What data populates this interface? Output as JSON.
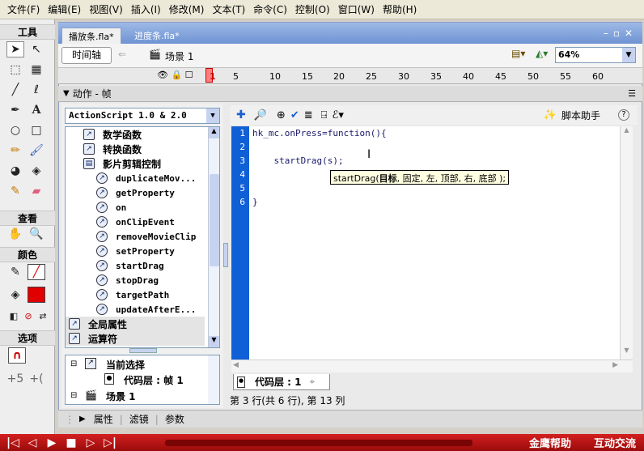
{
  "menu": [
    "文件(F)",
    "编辑(E)",
    "视图(V)",
    "插入(I)",
    "修改(M)",
    "文本(T)",
    "命令(C)",
    "控制(O)",
    "窗口(W)",
    "帮助(H)"
  ],
  "tools": {
    "title": "工具",
    "view": "查看",
    "colors": "颜色",
    "options": "选项"
  },
  "doc_tabs": [
    "播放条.fla*",
    "进度条.fla*"
  ],
  "timeline": {
    "button": "时间轴",
    "scene": "场景 1",
    "zoom": "64%",
    "frames": [
      "1",
      "5",
      "10",
      "15",
      "20",
      "25",
      "30",
      "35",
      "40",
      "45",
      "50",
      "55",
      "60"
    ]
  },
  "actions_panel": {
    "title": "动作 - 帧",
    "language": "ActionScript 1.0 & 2.0",
    "script_assist": "脚本助手"
  },
  "book": {
    "items": [
      {
        "label": "数学函数",
        "kind": "cat"
      },
      {
        "label": "转换函数",
        "kind": "cat"
      },
      {
        "label": "影片剪辑控制",
        "kind": "open"
      },
      {
        "label": "duplicateMov...",
        "kind": "fn"
      },
      {
        "label": "getProperty",
        "kind": "fn"
      },
      {
        "label": "on",
        "kind": "fn"
      },
      {
        "label": "onClipEvent",
        "kind": "fn"
      },
      {
        "label": "removeMovieClip",
        "kind": "fn"
      },
      {
        "label": "setProperty",
        "kind": "fn"
      },
      {
        "label": "startDrag",
        "kind": "fn"
      },
      {
        "label": "stopDrag",
        "kind": "fn"
      },
      {
        "label": "targetPath",
        "kind": "fn"
      },
      {
        "label": "updateAfterE...",
        "kind": "fn"
      },
      {
        "label": "全局属性",
        "kind": "sec"
      },
      {
        "label": "运算符",
        "kind": "sec"
      }
    ]
  },
  "tree": {
    "current": "当前选择",
    "layer_frame": "代码层 : 帧 1",
    "scene": "场景 1"
  },
  "code": {
    "lines": [
      "hk_mc.onPress=function(){",
      "",
      "    startDrag(s);",
      "",
      "",
      "}"
    ],
    "line_numbers": [
      "1",
      "2",
      "3",
      "4",
      "5",
      "6"
    ]
  },
  "tooltip": {
    "prefix": "startDrag(",
    "bold": "目标",
    "rest": ", 固定, 左, 顶部, 右, 底部 );"
  },
  "layer_tab": "代码层 : 1",
  "status": "第 3 行(共 6 行), 第 13 列",
  "props": [
    "属性",
    "滤镜",
    "参数"
  ],
  "bottom": {
    "help": "金鹰帮助",
    "interact": "互动交流"
  },
  "colors": {
    "gutter": "#0f5fd7",
    "bottom_bar": "#c01818",
    "tab_bar": "#7f9fd8"
  }
}
